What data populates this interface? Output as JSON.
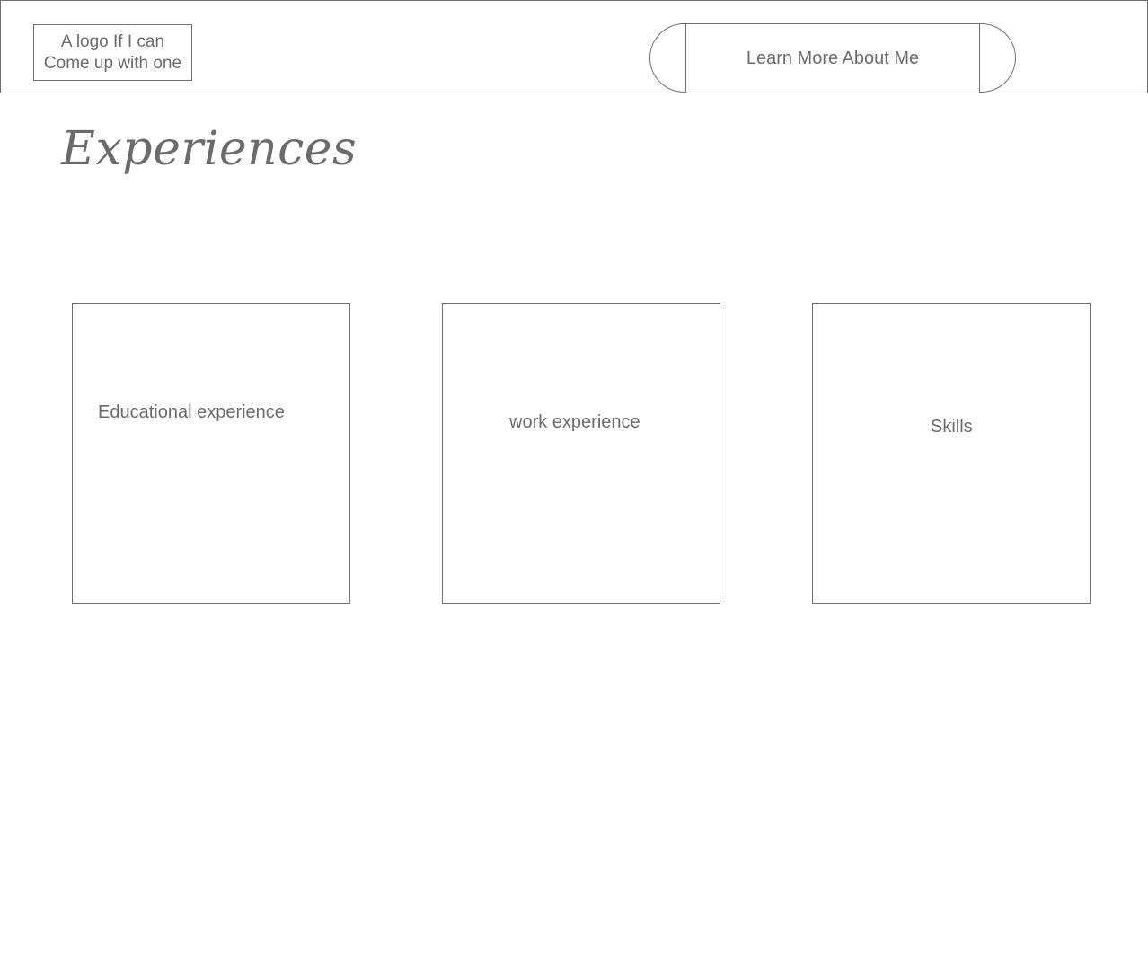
{
  "header": {
    "logo_lines": [
      "A logo If I can",
      "Come up with one"
    ],
    "nav_button_label": "Learn More About Me"
  },
  "main": {
    "title": "Experiences",
    "cards": [
      {
        "label": "Educational experience"
      },
      {
        "label": "work experience"
      },
      {
        "label": "Skills"
      }
    ]
  }
}
